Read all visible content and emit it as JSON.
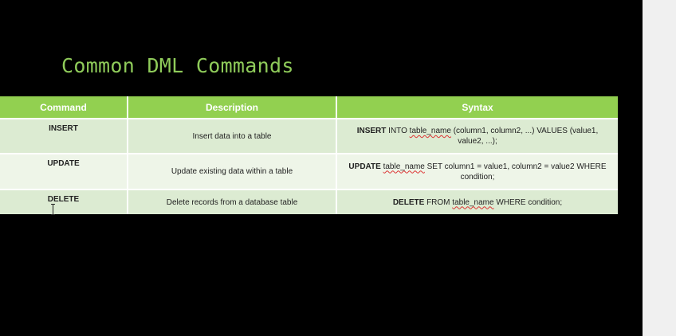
{
  "slide": {
    "title": "Common DML Commands"
  },
  "table": {
    "headers": [
      "Command",
      "Description",
      "Syntax"
    ],
    "rows": [
      {
        "command": "INSERT",
        "description": "Insert data into a table",
        "syntax": {
          "keyword": "INSERT",
          "pre": "INTO",
          "name": "table_name",
          "rest": "(column1, column2, ...) VALUES (value1, value2, ...);"
        }
      },
      {
        "command": "UPDATE",
        "description": "Update existing data within a table",
        "syntax": {
          "keyword": "UPDATE",
          "pre": "",
          "name": "table_name",
          "rest": "SET column1 = value1, column2 = value2 WHERE condition;"
        }
      },
      {
        "command": "DELETE",
        "description": "Delete records from a database table",
        "syntax": {
          "keyword": "DELETE",
          "pre": "FROM",
          "name": "table_name",
          "rest": "WHERE condition;"
        }
      }
    ]
  },
  "colors": {
    "header_bg": "#92d050",
    "row_dark": "#dcebd2",
    "row_light": "#eef5e8",
    "title": "#8fcb5a",
    "spell_squiggle": "#d33"
  }
}
